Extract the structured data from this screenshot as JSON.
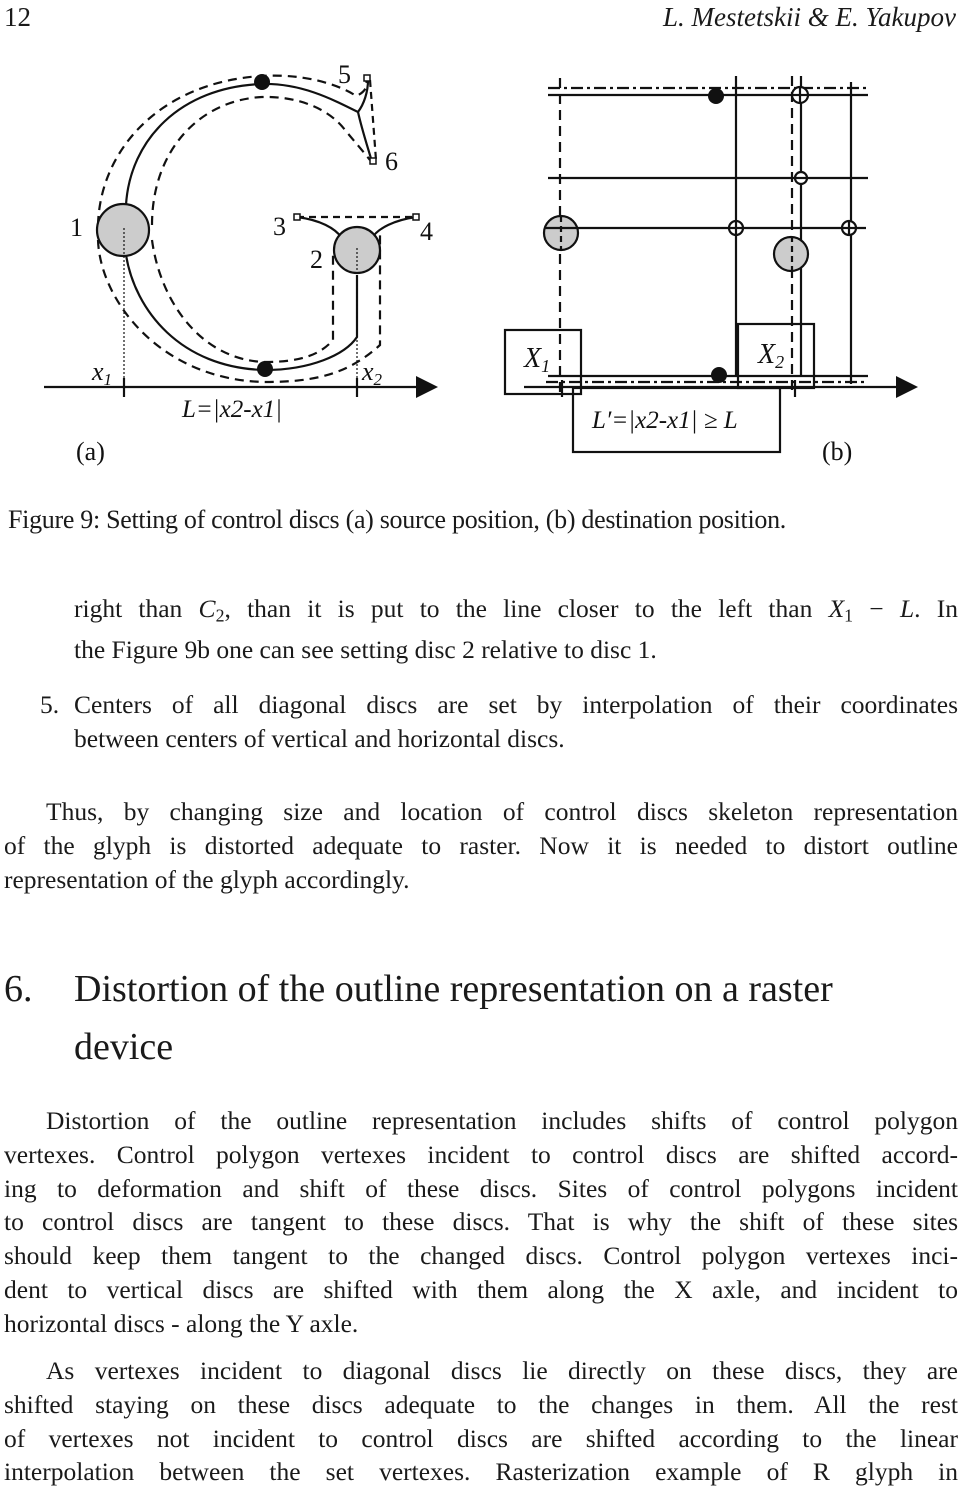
{
  "header": {
    "page_number": "12",
    "authors": "L. Mestetskii & E. Yakupov"
  },
  "figure": {
    "panel_a": {
      "label": "(a)",
      "disc_labels": [
        "1",
        "2",
        "3",
        "4",
        "5",
        "6"
      ],
      "x1_label": "x",
      "x1_sub": "1",
      "x2_label": "x",
      "x2_sub": "2",
      "length_formula": "L=|x2-x1|"
    },
    "panel_b": {
      "label": "(b)",
      "X1_label": "X",
      "X1_sub": "1",
      "X2_label": "X",
      "X2_sub": "2",
      "length_formula": "L′=|x2-x1| ≥ L"
    },
    "caption": "Figure 9: Setting of control discs (a) source position, (b) destination position."
  },
  "body": {
    "item4_continuation": {
      "line1_a": "right than ",
      "line1_c": "C",
      "line1_c_sub": "2",
      "line1_b": ", than it is put to the line closer to the left than ",
      "line1_x": "X",
      "line1_x_sub": "1",
      "line1_minus": " − ",
      "line1_l": "L",
      "line1_end": ". In",
      "line2": "the Figure 9b one can see setting disc 2 relative to disc 1."
    },
    "item5": {
      "number": "5.",
      "line1": "Centers of all diagonal discs are set by interpolation of their coordinates",
      "line2": "between centers of vertical and horizontal discs."
    },
    "paragraph_thus": [
      "Thus, by changing size and location of control discs skeleton representation",
      "of the glyph is distorted adequate to raster. Now it is needed to distort outline",
      "representation of the glyph accordingly."
    ],
    "section": {
      "number": "6.",
      "title_line1": "Distortion of the outline representation on a raster",
      "title_line2": "device"
    },
    "paragraph_distortion": [
      "Distortion of the outline representation includes shifts of control polygon",
      "vertexes. Control polygon vertexes incident to control discs are shifted accord-",
      "ing to deformation and shift of these discs. Sites of control polygons incident",
      "to control discs are tangent to these discs. That is why the shift of these sites",
      "should keep them tangent to the changed discs. Control polygon vertexes inci-",
      "dent to vertical discs are shifted with them along the X axle, and incident to",
      "horizontal discs - along the Y axle."
    ],
    "paragraph_as": [
      "As vertexes incident to diagonal discs lie directly on these discs, they are",
      "shifted staying on these discs adequate to the changes in them. All the rest",
      "of vertexes not incident to control discs are shifted according to the linear",
      "interpolation between the set vertexes. Rasterization example of R glyph in"
    ]
  }
}
